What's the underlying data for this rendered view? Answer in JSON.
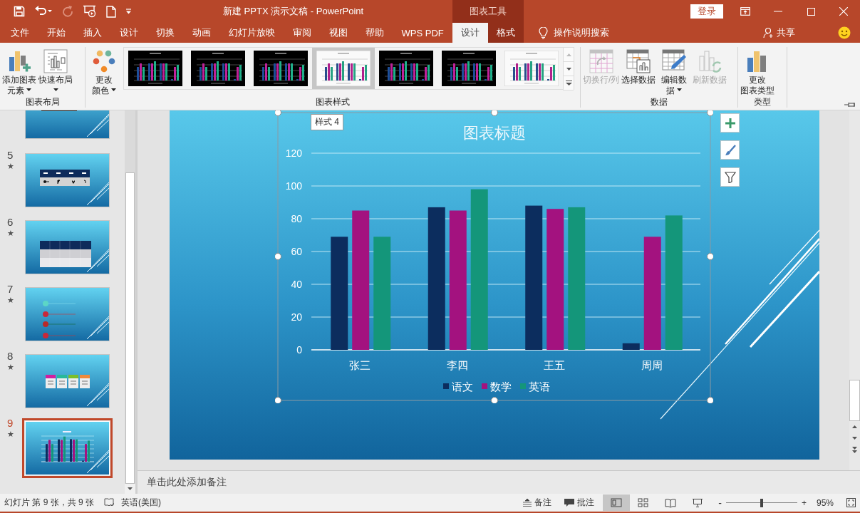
{
  "window": {
    "title": "新建 PPTX 演示文稿 - PowerPoint",
    "context_label": "图表工具",
    "sign_in": "登录"
  },
  "quick_access": [
    {
      "kind": "save",
      "disabled": false
    },
    {
      "kind": "undo",
      "disabled": false
    },
    {
      "kind": "redo",
      "disabled": true
    },
    {
      "kind": "present",
      "disabled": false
    },
    {
      "kind": "new",
      "disabled": false
    },
    {
      "kind": "customize",
      "disabled": false
    }
  ],
  "ribbon_tabs": [
    {
      "label": "文件",
      "selected": false,
      "context": false
    },
    {
      "label": "开始",
      "selected": false,
      "context": false
    },
    {
      "label": "插入",
      "selected": false,
      "context": false
    },
    {
      "label": "设计",
      "selected": false,
      "context": false
    },
    {
      "label": "切换",
      "selected": false,
      "context": false
    },
    {
      "label": "动画",
      "selected": false,
      "context": false
    },
    {
      "label": "幻灯片放映",
      "selected": false,
      "context": false
    },
    {
      "label": "审阅",
      "selected": false,
      "context": false
    },
    {
      "label": "视图",
      "selected": false,
      "context": false
    },
    {
      "label": "帮助",
      "selected": false,
      "context": false
    },
    {
      "label": "WPS PDF",
      "selected": false,
      "context": false
    },
    {
      "label": "设计",
      "selected": true,
      "context": true
    },
    {
      "label": "格式",
      "selected": false,
      "context": true
    }
  ],
  "tell_me": "操作说明搜索",
  "share": "共享",
  "ribbon_groups": [
    {
      "label": "图表布局",
      "kind": "buttons",
      "buttons": [
        {
          "lines": [
            "添加图表",
            "元素"
          ],
          "dropdown": true,
          "disabled": false
        },
        {
          "lines": [
            "快速布局"
          ],
          "dropdown": true,
          "disabled": false
        }
      ]
    },
    {
      "label": "图表样式",
      "kind": "gallery",
      "buttons": [
        {
          "lines": [
            "更改",
            "颜色"
          ],
          "dropdown": true,
          "disabled": false
        }
      ],
      "styles": [
        {
          "selected": false
        },
        {
          "selected": false
        },
        {
          "selected": false
        },
        {
          "selected": true
        },
        {
          "selected": false
        },
        {
          "selected": false
        },
        {
          "selected": false
        }
      ]
    },
    {
      "label": "数据",
      "kind": "buttons",
      "buttons": [
        {
          "lines": [
            "切换行/列"
          ],
          "dropdown": false,
          "disabled": true
        },
        {
          "lines": [
            "选择数据"
          ],
          "dropdown": false,
          "disabled": false
        },
        {
          "lines": [
            "编辑数",
            "据"
          ],
          "dropdown": true,
          "disabled": false
        },
        {
          "lines": [
            "刷新数据"
          ],
          "dropdown": false,
          "disabled": true
        }
      ]
    },
    {
      "label": "类型",
      "kind": "buttons",
      "buttons": [
        {
          "lines": [
            "更改",
            "图表类型"
          ],
          "dropdown": false,
          "disabled": false
        }
      ]
    }
  ],
  "slides": [
    {
      "selected": false
    },
    {
      "number": "5",
      "mark": "★",
      "selected": false
    },
    {
      "number": "6",
      "mark": "★",
      "selected": false
    },
    {
      "number": "7",
      "mark": "★",
      "selected": false
    },
    {
      "number": "8",
      "mark": "★",
      "selected": false
    },
    {
      "number": "9",
      "mark": "★",
      "selected": true
    }
  ],
  "chart": {
    "selected": true,
    "tooltip": "样式 4",
    "chart_data": {
      "type": "bar",
      "title": "图表标题",
      "categories": [
        "张三",
        "李四",
        "王五",
        "周周"
      ],
      "series": [
        {
          "name": "语文",
          "color": "#0c2d5e",
          "values": [
            69,
            87,
            88,
            4
          ]
        },
        {
          "name": "数学",
          "color": "#a3127f",
          "values": [
            85,
            85,
            86,
            69
          ]
        },
        {
          "name": "英语",
          "color": "#14967a",
          "values": [
            69,
            98,
            87,
            82
          ]
        }
      ],
      "ylim": [
        0,
        120
      ],
      "yticks": [
        0,
        20,
        40,
        60,
        80,
        100,
        120
      ],
      "grid": true,
      "legend": "bottom"
    }
  },
  "notes_placeholder": "单击此处添加备注",
  "status_bar": {
    "slide_info": "幻灯片 第 9 张，共 9 张",
    "language": "英语(美国)",
    "notes": "备注",
    "comments": "批注",
    "views": [
      {
        "kind": "normal",
        "selected": true
      },
      {
        "kind": "sorter",
        "selected": false
      },
      {
        "kind": "reading",
        "selected": false
      },
      {
        "kind": "slideshow",
        "selected": false
      }
    ],
    "zoom_minus": "-",
    "zoom_plus": "+",
    "zoom": {
      "level": 0.5
    },
    "zoom_reading": "95%"
  }
}
